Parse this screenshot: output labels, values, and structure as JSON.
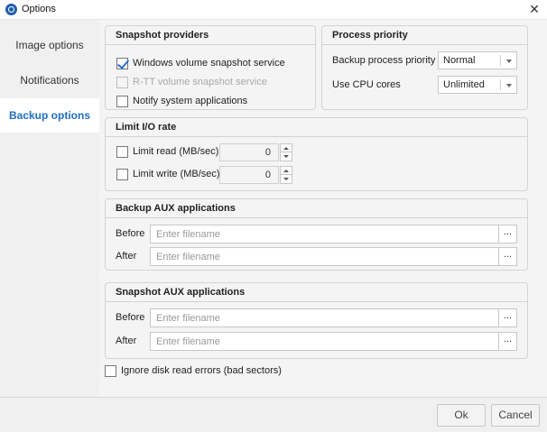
{
  "window": {
    "title": "Options",
    "close_glyph": "✕"
  },
  "sidebar": {
    "items": [
      {
        "label": "Image options"
      },
      {
        "label": "Notifications"
      },
      {
        "label": "Backup options",
        "active": true
      }
    ]
  },
  "snapshot_providers": {
    "title": "Snapshot providers",
    "options": [
      {
        "label": "Windows volume snapshot service",
        "checked": true,
        "disabled": false
      },
      {
        "label": "R-TT volume snapshot service",
        "checked": false,
        "disabled": true
      },
      {
        "label": "Notify system applications",
        "checked": false,
        "disabled": false
      }
    ]
  },
  "process_priority": {
    "title": "Process priority",
    "backup_priority": {
      "label": "Backup process priority",
      "value": "Normal"
    },
    "cpu_cores": {
      "label": "Use CPU cores",
      "value": "Unlimited"
    }
  },
  "limit_io": {
    "title": "Limit I/O rate",
    "read": {
      "label": "Limit read (MB/sec)",
      "value": "0",
      "checked": false
    },
    "write": {
      "label": "Limit write (MB/sec)",
      "value": "0",
      "checked": false
    }
  },
  "backup_aux": {
    "title": "Backup AUX applications",
    "before": {
      "label": "Before",
      "placeholder": "Enter filename"
    },
    "after": {
      "label": "After",
      "placeholder": "Enter filename"
    },
    "browse_label": "..."
  },
  "snapshot_aux": {
    "title": "Snapshot AUX applications",
    "before": {
      "label": "Before",
      "placeholder": "Enter filename"
    },
    "after": {
      "label": "After",
      "placeholder": "Enter filename"
    },
    "browse_label": "..."
  },
  "ignore_errors": {
    "label": "Ignore disk read errors (bad sectors)",
    "checked": false
  },
  "footer": {
    "ok_label": "Ok",
    "cancel_label": "Cancel"
  },
  "colors": {
    "accent": "#1f6fbf",
    "check": "#2a6fd1"
  },
  "icons": {
    "app": "app-logo-icon",
    "close": "close-icon",
    "dropdown": "chevron-down-icon",
    "spin": "spin-arrows-icon"
  }
}
